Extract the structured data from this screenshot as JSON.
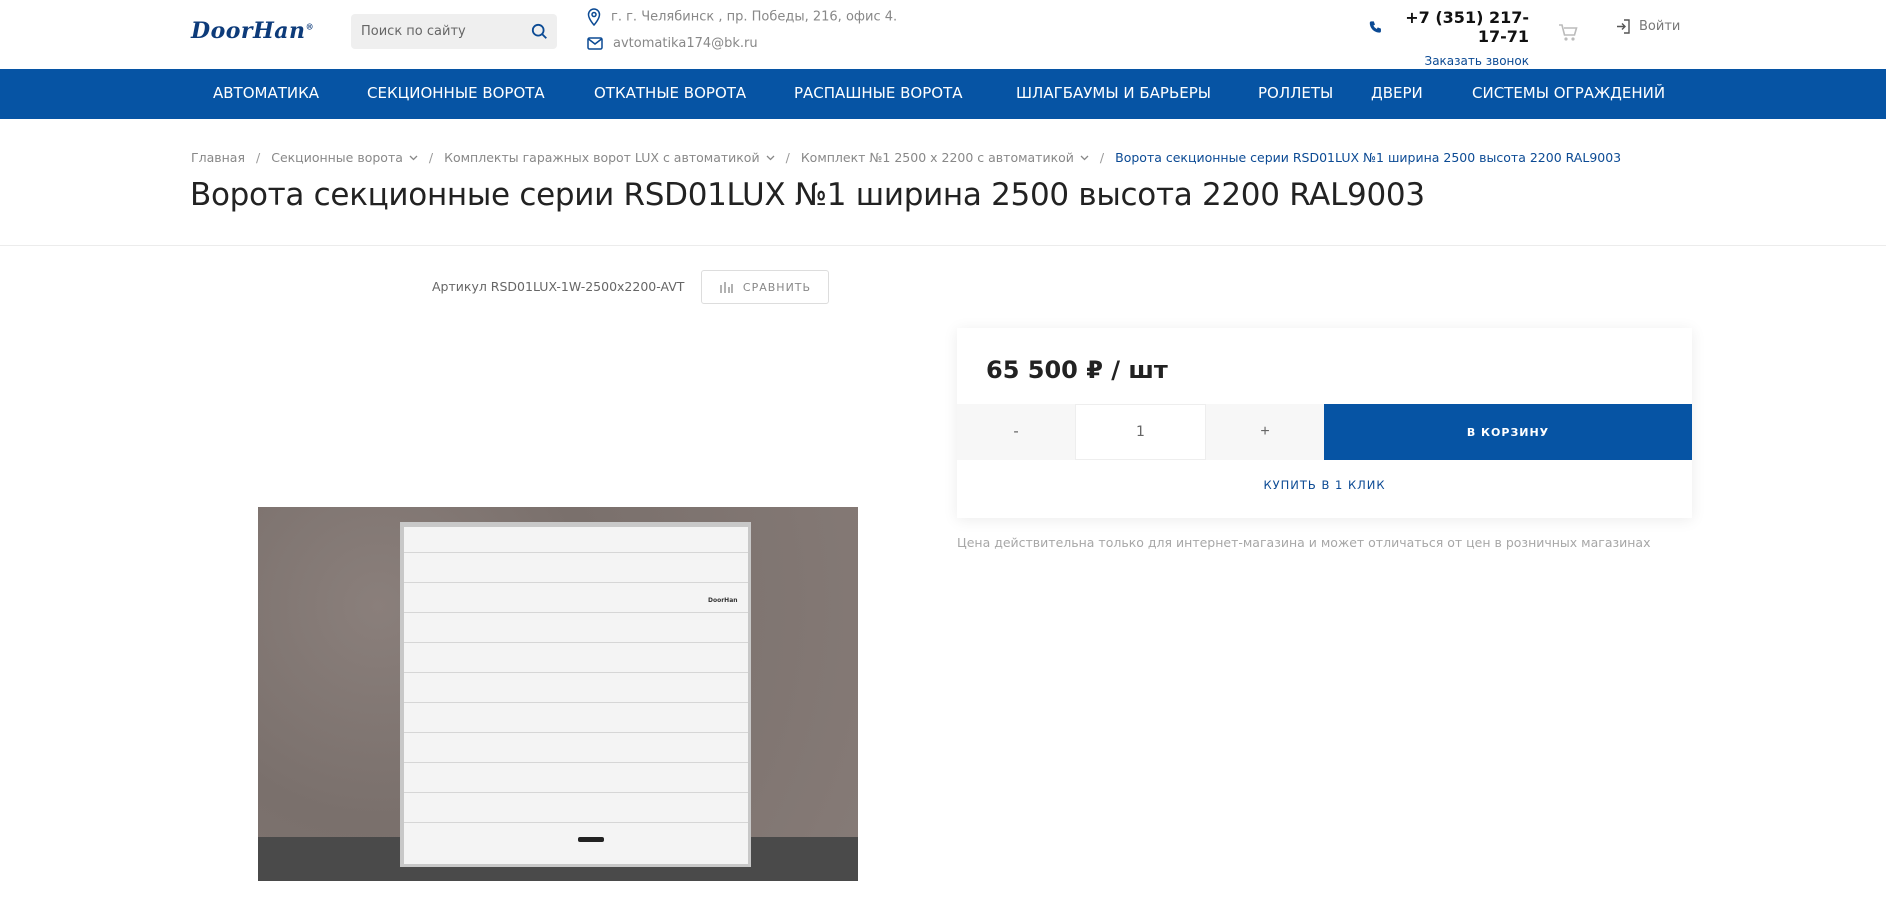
{
  "header": {
    "logo_text": "DoorHan",
    "logo_mark": "®",
    "search_placeholder": "Поиск по сайту",
    "address": "г. г. Челябинск , пр. Победы, 216, офис 4.",
    "email": "avtomatika174@bk.ru",
    "phone": "+7 (351) 217-17-71",
    "callback_label": "Заказать звонок",
    "login_label": "Войти"
  },
  "nav": {
    "items": [
      "АВТОМАТИКА",
      "СЕКЦИОННЫЕ ВОРОТА",
      "ОТКАТНЫЕ ВОРОТА",
      "РАСПАШНЫЕ ВОРОТА",
      "ШЛАГБАУМЫ И БАРЬЕРЫ",
      "РОЛЛЕТЫ",
      "ДВЕРИ",
      "СИСТЕМЫ ОГРАЖДЕНИЙ"
    ]
  },
  "breadcrumb": {
    "items": [
      "Главная",
      "Секционные ворота",
      "Комплекты гаражных ворот LUX с автоматикой",
      "Комплект №1 2500 x 2200 с автоматикой",
      "Ворота секционные серии RSD01LUX №1 ширина 2500 высота 2200 RAL9003"
    ]
  },
  "product": {
    "title": "Ворота секционные серии RSD01LUX №1 ширина 2500 высота 2200 RAL9003",
    "sku": "Артикул RSD01LUX-1W-2500x2200-AVT",
    "compare_label": "СРАВНИТЬ",
    "gate_logo": "DoorHan"
  },
  "purchase": {
    "price": "65 500 ₽ / шт",
    "minus_label": "-",
    "quantity": "1",
    "plus_label": "+",
    "add_to_cart_label": "В КОРЗИНУ",
    "one_click_label": "КУПИТЬ В 1 КЛИК",
    "price_note": "Цена действительна только для интернет-магазина и может отличаться от цен в розничных магазинах"
  },
  "colors": {
    "brand_blue": "#0654a4",
    "link_blue": "#0b4a94"
  },
  "icons": [
    "search-icon",
    "location-icon",
    "mail-icon",
    "phone-icon",
    "cart-icon",
    "login-icon",
    "compare-icon",
    "chevron-down-icon"
  ]
}
